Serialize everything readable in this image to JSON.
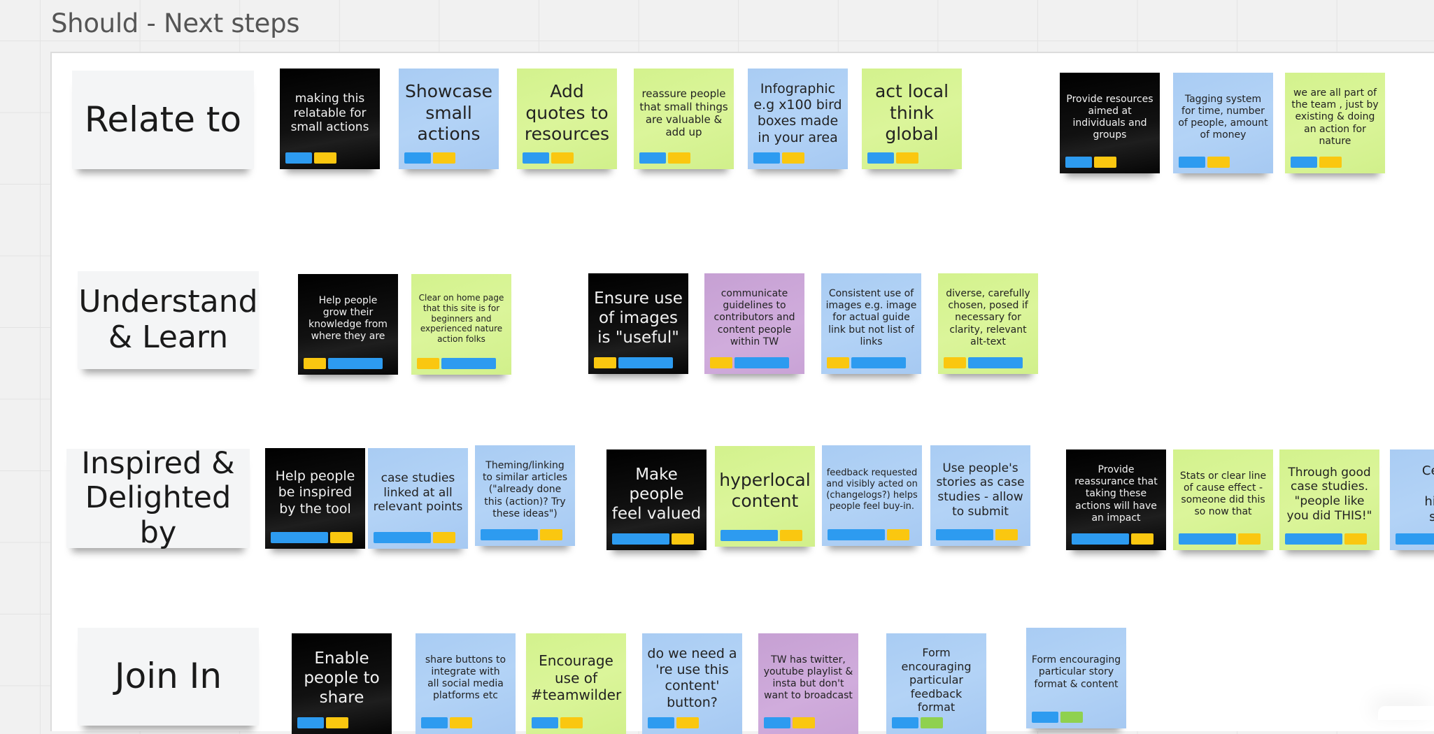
{
  "frame": {
    "title": "Should - Next steps"
  },
  "rows": [
    {
      "label": [
        "Relate to"
      ],
      "notes": [
        {
          "color": "black",
          "text": [
            "making this",
            "relatable for",
            "small actions"
          ],
          "tags": [
            "blue",
            "yellow"
          ]
        },
        {
          "color": "blue",
          "text": [
            "Showcase",
            "small",
            "actions"
          ],
          "tags": [
            "blue",
            "yellow"
          ]
        },
        {
          "color": "green",
          "text": [
            "Add",
            "quotes to",
            "resources"
          ],
          "tags": [
            "blue",
            "yellow"
          ]
        },
        {
          "color": "green",
          "text": [
            "reassure people",
            "that small things",
            "are valuable &",
            "add up"
          ],
          "tags": [
            "blue",
            "yellow"
          ]
        },
        {
          "color": "blue",
          "text": [
            "Infographic",
            "e.g  x100 bird",
            "boxes made",
            "in your area"
          ],
          "tags": [
            "blue",
            "yellow"
          ]
        },
        {
          "color": "green",
          "text": [
            "act local",
            "think",
            "global"
          ],
          "tags": [
            "blue",
            "yellow"
          ]
        },
        {
          "color": "black",
          "text": [
            "Provide resources",
            "aimed at",
            "individuals and",
            "groups"
          ],
          "tags": [
            "blue",
            "yellow"
          ]
        },
        {
          "color": "blue",
          "text": [
            "Tagging system",
            "for time, number",
            "of people, amount",
            "of money"
          ],
          "tags": [
            "blue",
            "yellow"
          ]
        },
        {
          "color": "green",
          "text": [
            "we are all part of",
            "the team , just by",
            "existing & doing",
            "an action for",
            "nature"
          ],
          "tags": [
            "blue",
            "yellow"
          ]
        }
      ]
    },
    {
      "label": [
        "Understand",
        "& Learn"
      ],
      "notes": [
        {
          "color": "black",
          "text": [
            "Help people",
            "grow their",
            "knowledge from",
            "where they are"
          ],
          "tags": [
            "yellow",
            "blue"
          ]
        },
        {
          "color": "green",
          "text": [
            "Clear on home page",
            "that this site is for",
            "beginners and",
            "experienced nature",
            "action folks"
          ],
          "tags": [
            "yellow",
            "blue"
          ]
        },
        {
          "color": "black",
          "text": [
            "Ensure use",
            "of images",
            "is \"useful\""
          ],
          "tags": [
            "yellow",
            "blue"
          ]
        },
        {
          "color": "purple",
          "text": [
            "communicate",
            "guidelines to",
            "contributors and",
            "content people",
            "within TW"
          ],
          "tags": [
            "yellow",
            "blue"
          ]
        },
        {
          "color": "blue",
          "text": [
            "Consistent use of",
            "images e.g. image",
            "for actual guide",
            "link but not list of",
            "links"
          ],
          "tags": [
            "yellow",
            "blue"
          ]
        },
        {
          "color": "green",
          "text": [
            "diverse, carefully",
            "chosen, posed if",
            "necessary for",
            "clarity, relevant",
            "alt-text"
          ],
          "tags": [
            "yellow",
            "blue"
          ]
        }
      ]
    },
    {
      "label": [
        "Inspired &",
        "Delighted by"
      ],
      "notes": [
        {
          "color": "black",
          "text": [
            "Help people",
            "be inspired",
            "by  the tool"
          ],
          "tags": [
            "blue",
            "yellow"
          ]
        },
        {
          "color": "blue",
          "text": [
            "case studies",
            "linked at all",
            "relevant points"
          ],
          "tags": [
            "blue",
            "yellow"
          ]
        },
        {
          "color": "blue",
          "text": [
            "Theming/linking",
            "to similar articles",
            "(\"already done",
            "this (action)? Try",
            "these ideas\")"
          ],
          "tags": [
            "blue",
            "yellow"
          ]
        },
        {
          "color": "black",
          "text": [
            "Make",
            "people",
            "feel valued"
          ],
          "tags": [
            "blue",
            "yellow"
          ]
        },
        {
          "color": "green",
          "text": [
            "hyperlocal",
            "content"
          ],
          "tags": [
            "blue",
            "yellow"
          ]
        },
        {
          "color": "blue",
          "text": [
            "feedback requested",
            "and visibly acted on",
            "(changelogs?) helps",
            "people feel buy-in."
          ],
          "tags": [
            "blue",
            "yellow"
          ]
        },
        {
          "color": "blue",
          "text": [
            "Use people's",
            "stories as case",
            "studies - allow",
            "to submit"
          ],
          "tags": [
            "blue",
            "yellow"
          ]
        },
        {
          "color": "black",
          "text": [
            "Provide",
            "reassurance that",
            "taking these",
            "actions will have",
            "an impact"
          ],
          "tags": [
            "blue",
            "yellow"
          ]
        },
        {
          "color": "green",
          "text": [
            "Stats or clear line",
            "of cause effect -",
            "someone did this",
            "so now that"
          ],
          "tags": [
            "blue",
            "yellow"
          ]
        },
        {
          "color": "green",
          "text": [
            "Through good",
            "case studies.",
            "\"people like",
            "you did THIS!\""
          ],
          "tags": [
            "blue",
            "yellow"
          ]
        },
        {
          "color": "blue",
          "text": [
            "Celeb",
            "b",
            "highl",
            "suc"
          ],
          "tags": [
            "blue"
          ]
        }
      ]
    },
    {
      "label": [
        "Join In"
      ],
      "notes": [
        {
          "color": "black",
          "text": [
            "Enable",
            "people to",
            "share"
          ],
          "tags": [
            "blue",
            "yellow"
          ]
        },
        {
          "color": "blue",
          "text": [
            "share buttons to",
            "integrate with",
            "all social media",
            "platforms etc"
          ],
          "tags": [
            "blue",
            "yellow"
          ]
        },
        {
          "color": "green",
          "text": [
            "Encourage",
            "use of",
            "#teamwilder"
          ],
          "tags": [
            "blue",
            "yellow"
          ]
        },
        {
          "color": "blue",
          "text": [
            "do we need a",
            "'re use this",
            "content'",
            "button?"
          ],
          "tags": [
            "blue",
            "yellow"
          ]
        },
        {
          "color": "purple",
          "text": [
            "TW has twitter,",
            "youtube playlist  &",
            "insta  but don't",
            "want to broadcast"
          ],
          "tags": [
            "blue",
            "yellow"
          ]
        },
        {
          "color": "blue",
          "text": [
            "Form",
            "encouraging",
            "particular",
            "feedback format"
          ],
          "tags": [
            "blue",
            "green"
          ]
        },
        {
          "color": "blue",
          "text": [
            "Form encouraging",
            "particular story",
            "format & content"
          ],
          "tags": [
            "blue",
            "green"
          ]
        }
      ]
    }
  ]
}
